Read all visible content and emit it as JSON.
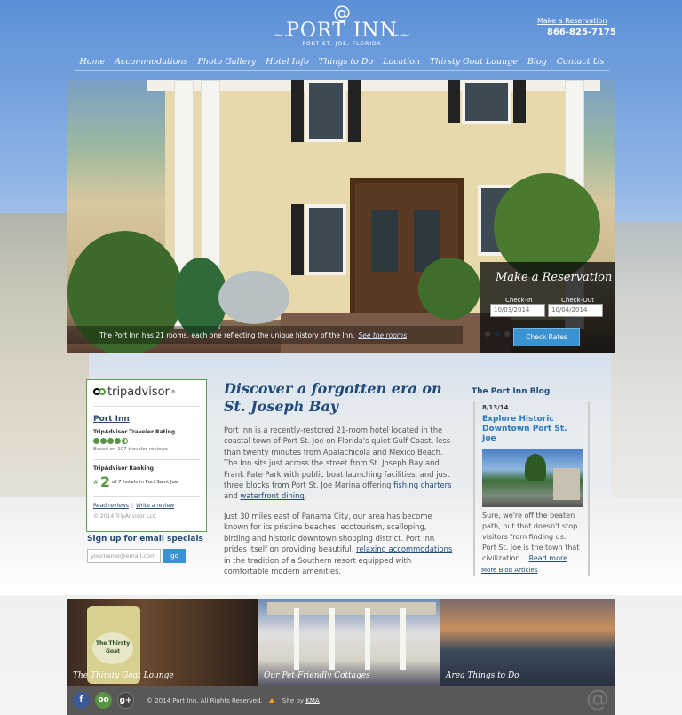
{
  "header": {
    "logo_name": "PORT INN",
    "logo_sub": "PORT ST. JOE, FLORIDA",
    "reservation_link": "Make a Reservation",
    "phone": "866-825-7175"
  },
  "nav": {
    "items": [
      "Home",
      "Accommodations",
      "Photo Gallery",
      "Hotel Info",
      "Things to Do",
      "Location",
      "Thirsty Goat Lounge",
      "Blog",
      "Contact Us"
    ]
  },
  "hero": {
    "caption": "The Port Inn has 21 rooms, each one reflecting the unique history of the Inn.",
    "caption_link": "See the rooms",
    "slides": 4,
    "active_slide": 2
  },
  "reservation": {
    "title": "Make a Reservation",
    "checkin_label": "Check-In",
    "checkout_label": "Check-Out",
    "checkin_value": "10/03/2014",
    "checkout_value": "10/04/2014",
    "button": "Check Rates"
  },
  "tripadvisor": {
    "logo": "tripadvisor",
    "reg": "®",
    "hotel_name": "Port Inn",
    "rating_label": "TripAdvisor Traveler Rating",
    "rating_value": 4.5,
    "based_on": "Based on 107 traveler reviews",
    "ranking_label": "TripAdvisor Ranking",
    "rank_hash": "#",
    "rank_number": "2",
    "rank_text": "of 7 hotels in Port Saint Joe",
    "read_reviews": "Read reviews",
    "write_review": "Write a review",
    "copyright": "© 2014 TripAdvisor LLC"
  },
  "email_signup": {
    "title": "Sign up for email specials",
    "placeholder": "yourname@email.com",
    "button": "go"
  },
  "main": {
    "title": "Discover a forgotten era on St. Joseph Bay",
    "p1_a": "Port Inn is a recently-restored 21-room hotel located in the coastal town of Port St. Joe on Florida's quiet Gulf Coast, less than twenty minutes from Apalachicola and Mexico Beach. The Inn sits just across the street from St. Joseph Bay and Frank Pate Park with public boat launching facilities, and just three blocks from Port St. Joe Marina offering ",
    "p1_link1": "fishing charters",
    "p1_mid": " and ",
    "p1_link2": "waterfront dining",
    "p1_end": ".",
    "p2_a": "Just 30 miles east of Panama City, our area has become known for its pristine beaches, ecotourism, scalloping, birding and historic downtown shopping district. Port Inn prides itself on providing beautiful, ",
    "p2_link": "relaxing accommodations",
    "p2_end": " in the tradition of a Southern resort equipped with comfortable modern amenities."
  },
  "blog": {
    "title": "The Port Inn Blog",
    "date": "8/13/14",
    "headline": "Explore Historic Downtown Port St. Joe",
    "excerpt": "Sure, we're off the beaten path, but that doesn't stop visitors from finding us. Port St. Joe is the town that civilization... ",
    "read_more": "Read more",
    "more_articles": "More Blog Articles"
  },
  "promos": [
    {
      "label": "The Thirsty Goat Lounge",
      "badge": "The Thirsty Goat"
    },
    {
      "label": "Our Pet-Friendly Cottages"
    },
    {
      "label": "Area Things to Do"
    }
  ],
  "footer": {
    "social": [
      "f",
      "oo",
      "g+"
    ],
    "copyright": "© 2014 Port Inn. All Rights Reserved.",
    "site_by_label": "Site by",
    "site_by_link": "KMA"
  },
  "colors": {
    "accent_blue": "#3a92d0",
    "title_navy": "#1f4a7a",
    "tripadvisor_green": "#589442",
    "footer_gray": "#5a5856"
  }
}
